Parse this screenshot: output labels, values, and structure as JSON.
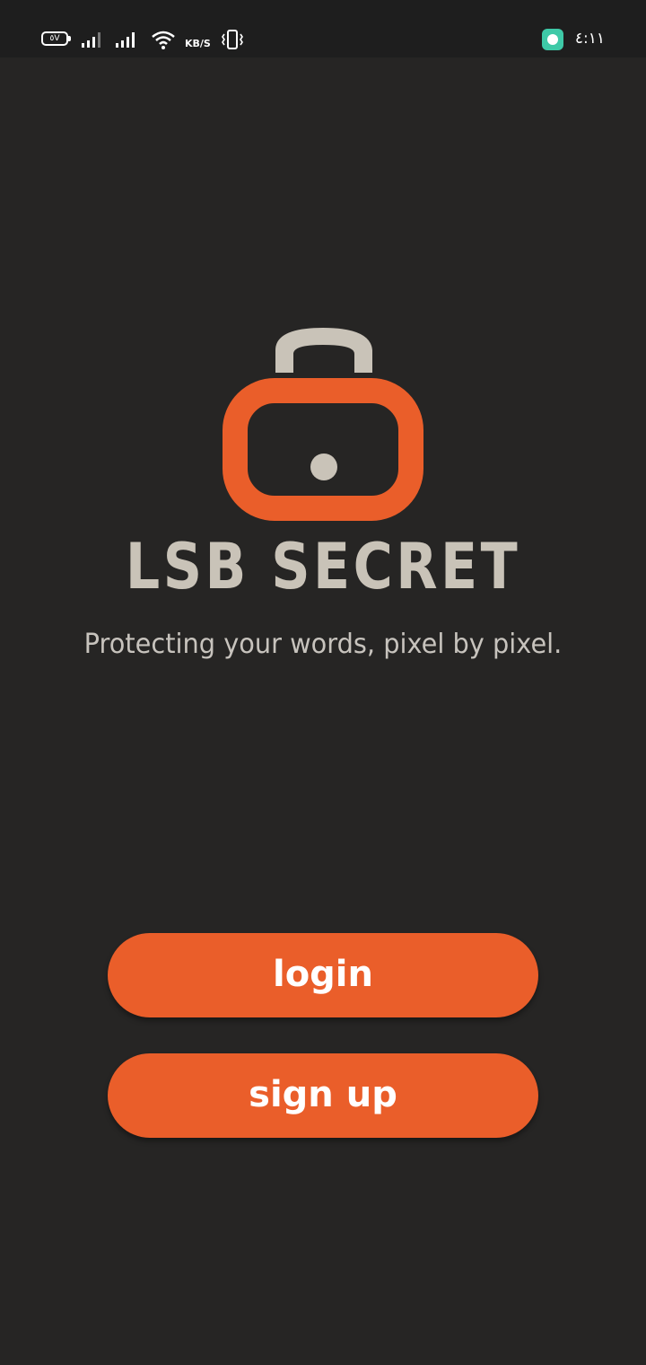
{
  "status_bar": {
    "battery_text": "٥V",
    "network_speed": "KB/S",
    "time": "٤:١١"
  },
  "brand": {
    "title": "LSB SECRET",
    "tagline": "Protecting your words, pixel by pixel."
  },
  "actions": {
    "login_label": "login",
    "signup_label": "sign up"
  },
  "colors": {
    "background": "#262524",
    "accent": "#ea5e2a",
    "logo_light": "#c9c3b8",
    "status_bar": "#1e1e1e"
  },
  "icons": [
    "battery-icon",
    "cell-signal-icon",
    "wifi-icon",
    "vibrate-icon",
    "app-notification-icon",
    "padlock-logo"
  ]
}
